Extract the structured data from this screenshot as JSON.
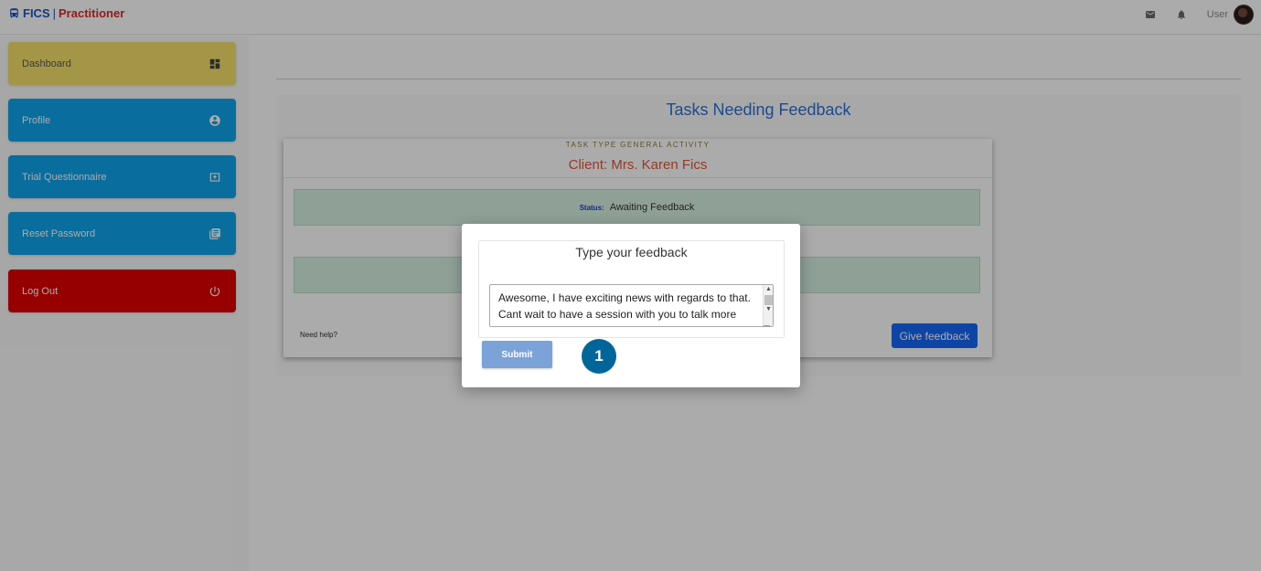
{
  "header": {
    "brand_name": "FICS",
    "brand_separator": "|",
    "brand_role": "Practitioner",
    "user_label": "User",
    "icons": [
      "bus-icon",
      "mail-icon",
      "bell-icon",
      "avatar"
    ]
  },
  "sidebar": {
    "items": [
      {
        "label": "Dashboard",
        "icon": "dashboard-icon",
        "color": "#f5e06a"
      },
      {
        "label": "Profile",
        "icon": "account-circle-icon",
        "color": "#0ea5ea"
      },
      {
        "label": "Trial Questionnaire",
        "icon": "upload-box-icon",
        "color": "#0ea5ea"
      },
      {
        "label": "Reset Password",
        "icon": "library-books-icon",
        "color": "#0ea5ea"
      },
      {
        "label": "Log Out",
        "icon": "power-icon",
        "color": "#e00000"
      }
    ]
  },
  "main": {
    "title": "Tasks Needing Feedback",
    "card": {
      "task_type": "TASK TYPE GENERAL ACTIVITY",
      "client": "Client: Mrs. Karen Fics",
      "status_label": "Status:",
      "status_value": "Awaiting Feedback",
      "help_text": "Need help?",
      "give_feedback_label": "Give feedback"
    }
  },
  "modal": {
    "title": "Type your feedback",
    "feedback_text": "Awesome, I have exciting news with regards to that. Cant wait to have a session with you to talk more about your Profile.",
    "submit_label": "Submit"
  },
  "step_badge": "1",
  "colors": {
    "brand_blue": "#1a56c9",
    "brand_red": "#d92b2b",
    "title_blue": "#2c6fd6",
    "client_orange": "#e0553a",
    "button_blue": "#1668f5",
    "badge": "#006699"
  }
}
